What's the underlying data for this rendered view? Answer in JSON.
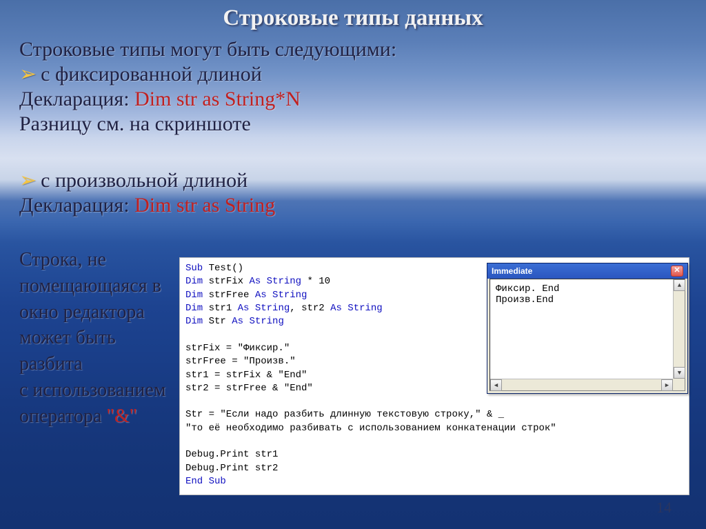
{
  "title": "Строковые типы данных",
  "intro": "Строковые типы могут быть следующими:",
  "fixed": {
    "label": "с фиксированной длиной",
    "decl_label": "Декларация: ",
    "decl_code": "Dim str as String*N",
    "note": "Разницу см. на скриншоте"
  },
  "variable": {
    "label": "с произвольной длиной",
    "decl_label": "Декларация: ",
    "decl_code": "Dim str as String"
  },
  "sidenote": {
    "l1": "Строка, не",
    "l2": "помещающаяся в",
    "l3": "окно редактора",
    "l4": "может быть разбита",
    "l5": "с использованием",
    "l6a": "оператора ",
    "l6b": "\"&\""
  },
  "code": {
    "l1a": "Sub",
    "l1b": " Test()",
    "l2a": "Dim",
    "l2b": " strFix ",
    "l2c": "As String",
    "l2d": " * 10",
    "l3a": "Dim",
    "l3b": " strFree ",
    "l3c": "As String",
    "l4a": "Dim",
    "l4b": " str1 ",
    "l4c": "As String",
    "l4d": ", str2 ",
    "l4e": "As String",
    "l5a": "Dim",
    "l5b": " Str ",
    "l5c": "As String",
    "l7": "strFix = \"Фиксир.\"",
    "l8": "strFree = \"Произв.\"",
    "l9": "str1 = strFix & \"End\"",
    "l10": "str2 = strFree & \"End\"",
    "l12": "Str = \"Если надо разбить длинную текстовую строку,\" & _",
    "l13": "\"то её необходимо разбивать с использованием конкатенации строк\"",
    "l15": "Debug.Print str1",
    "l16": "Debug.Print str2",
    "l17": "End Sub"
  },
  "immediate": {
    "title": "Immediate",
    "line1": "Фиксир.   End",
    "line2": "Произв.End"
  },
  "pagenum": "14"
}
